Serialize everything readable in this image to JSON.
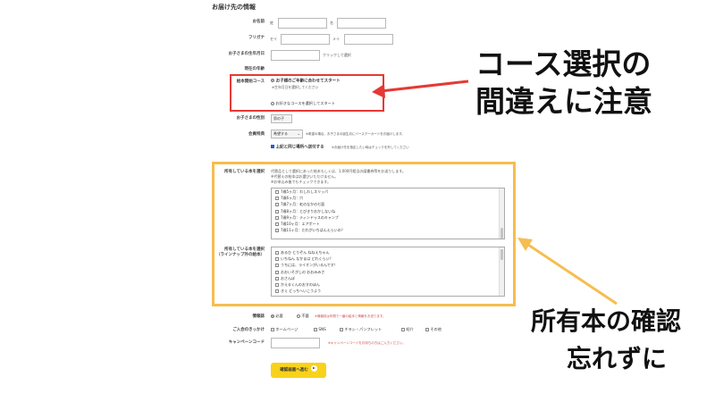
{
  "form": {
    "section_title": "お届け先の情報",
    "name": {
      "label": "お名前",
      "sei": "姓",
      "mei": "名"
    },
    "kana": {
      "label": "フリガナ",
      "sei": "セイ",
      "mei": "メイ"
    },
    "birthday": {
      "label": "お子さまの生年月日",
      "hint": "クリックして選択"
    },
    "age": {
      "label": "現在の年齢"
    },
    "course": {
      "label": "絵本開始コース",
      "option1": "お子様のご年齢に合わせてスタート",
      "option1_note": "※生年月日を選択してください",
      "option2": "お好きなコースを選択してスタート"
    },
    "gender": {
      "label": "お子さまの性別",
      "value": "男の子"
    },
    "benefit": {
      "label": "会員特典",
      "value": "希望する",
      "note": "※希望の場合、お子さまの誕生月にバースデーカードをお届けします。",
      "same_address": "上記と同じ場所へ送付する",
      "same_address_note": "※お届け先を指定したい時はチェックを外してください"
    },
    "owned_books": {
      "label": "所有している本を選択",
      "desc_line1": "代替品として選択にあった絵本もしくは、1,000円相当の図書券等をお送りします。",
      "desc_line2": "※代替えの絵本はお選びいただけません。",
      "desc_line3": "※お申込み後でもチェックできます。",
      "items": [
        "7歳5ヶ月：わしわしスリッパ",
        "7歳6ヶ月：穴",
        "7歳7ヶ月：虹のなかの七面",
        "7歳8ヶ月：とびきりおかしないね",
        "7歳9ヶ月：ティンドゥスのキャンプ",
        "7歳10ヶ月：エアポート",
        "7歳11ヶ月：だれがいちばんえらいの？"
      ]
    },
    "owned_books_other": {
      "label": "所有している本を選択",
      "label2": "（ラインナップ外の絵本）",
      "items": [
        "あるひ とりぞん ねねえちゃん",
        "いちねん なかまは どれくらい？",
        "うちには、ライオンがいるんです！",
        "おおいそがしの おおみみさ",
        "おさんぽ",
        "かえるくんのおすのほん",
        "きぇ どっちへいこうよう"
      ]
    },
    "newsletter": {
      "label": "情報誌",
      "yes": "必要",
      "no": "不要",
      "note": "※情報誌は年間で一番の絵本と情報をお送ります。"
    },
    "source": {
      "label": "ご入会のきっかけ",
      "options": [
        "ホームページ",
        "SNS",
        "チラシ・パンフレット",
        "紹介",
        "その他"
      ]
    },
    "campaign": {
      "label": "キャンペーンコード",
      "note": "※キャンペーンコードをお持ちの方はご入力ください。"
    },
    "submit": "確認画面へ進む"
  },
  "annotations": {
    "course_line1": "コース選択の",
    "course_line2": "間違えに注意",
    "owned_line1": "所有本の確認",
    "owned_line2": "忘れずに"
  },
  "colors": {
    "red": "#e53935",
    "orange": "#f6bd4f",
    "submit": "#f8d21a"
  }
}
